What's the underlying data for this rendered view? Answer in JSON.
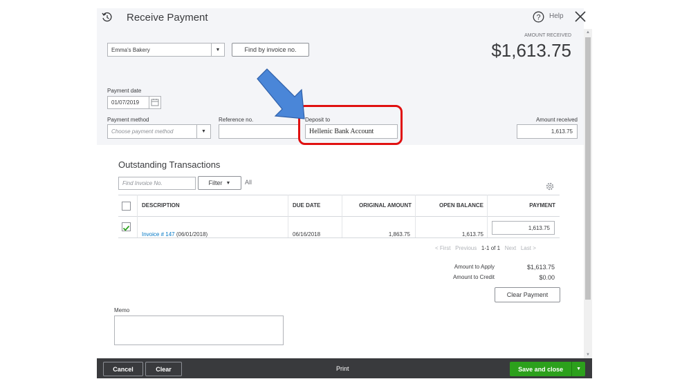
{
  "header": {
    "title": "Receive Payment",
    "help_label": "Help",
    "amount_received_caption": "AMOUNT RECEIVED",
    "amount_received_value": "$1,613.75"
  },
  "customer": {
    "value": "Emma's Bakery",
    "find_button": "Find by invoice no."
  },
  "payment_date": {
    "label": "Payment date",
    "value": "01/07/2019"
  },
  "payment_method": {
    "label": "Payment method",
    "placeholder": "Choose payment method"
  },
  "reference": {
    "label": "Reference no.",
    "value": ""
  },
  "deposit_to": {
    "label": "Deposit to",
    "value": "Hellenic Bank Account"
  },
  "amount_received_field": {
    "label": "Amount received",
    "value": "1,613.75"
  },
  "outstanding": {
    "title": "Outstanding Transactions",
    "find_placeholder": "Find Invoice No.",
    "filter_label": "Filter",
    "all_label": "All",
    "columns": [
      "DESCRIPTION",
      "DUE DATE",
      "ORIGINAL AMOUNT",
      "OPEN BALANCE",
      "PAYMENT"
    ],
    "rows": [
      {
        "invoice_link": "Invoice # 147",
        "invoice_date": "(06/01/2018)",
        "due_date": "06/16/2018",
        "original_amount": "1,863.75",
        "open_balance": "1,613.75",
        "payment": "1,613.75",
        "checked": true
      }
    ]
  },
  "pagination": {
    "first": "< First",
    "previous": "Previous",
    "range": "1-1 of 1",
    "next": "Next",
    "last": "Last >"
  },
  "totals": {
    "apply_label": "Amount to Apply",
    "apply_value": "$1,613.75",
    "credit_label": "Amount to Credit",
    "credit_value": "$0.00",
    "clear_payment": "Clear Payment"
  },
  "memo": {
    "label": "Memo",
    "value": ""
  },
  "footer": {
    "cancel": "Cancel",
    "clear": "Clear",
    "print": "Print",
    "save": "Save and close"
  },
  "colors": {
    "highlight_red": "#e01010",
    "arrow_blue": "#4a86d8",
    "save_green": "#2ca01c",
    "link_blue": "#0077c5"
  }
}
